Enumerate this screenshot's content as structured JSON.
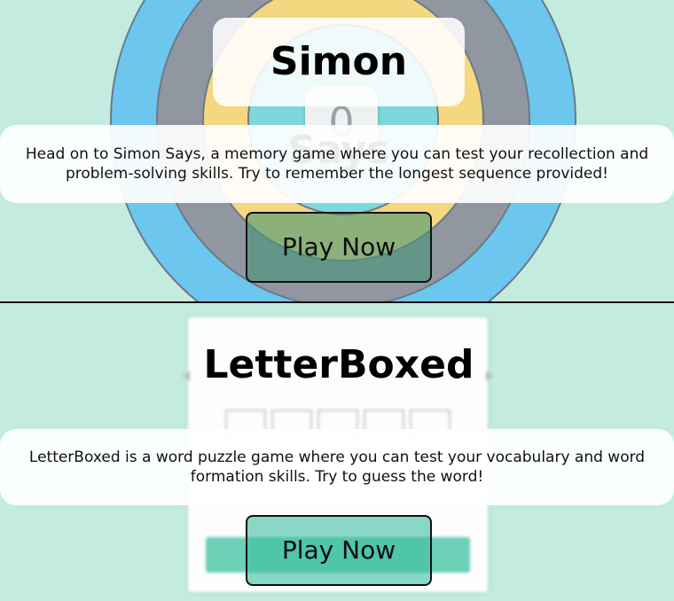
{
  "games": [
    {
      "title": "Simon Says",
      "description": "Head on to Simon Says, a memory game where you can test your recollection and problem-solving skills. Try to remember the longest sequence provided!",
      "play_label": "Play Now",
      "center_key": "0"
    },
    {
      "title": "LetterBoxed",
      "description": "LetterBoxed is a word puzzle game where you can test your vocabulary and word formation skills. Try to guess the word!",
      "play_label": "Play Now"
    }
  ],
  "colors": {
    "background": "#c3ebe0",
    "simon_outer": "#6cc6ee",
    "simon_gray": "#9097a0",
    "simon_yellow": "#f4d77e",
    "simon_cyan": "#7dd8dc",
    "button_fill": "#3cbe9f"
  }
}
